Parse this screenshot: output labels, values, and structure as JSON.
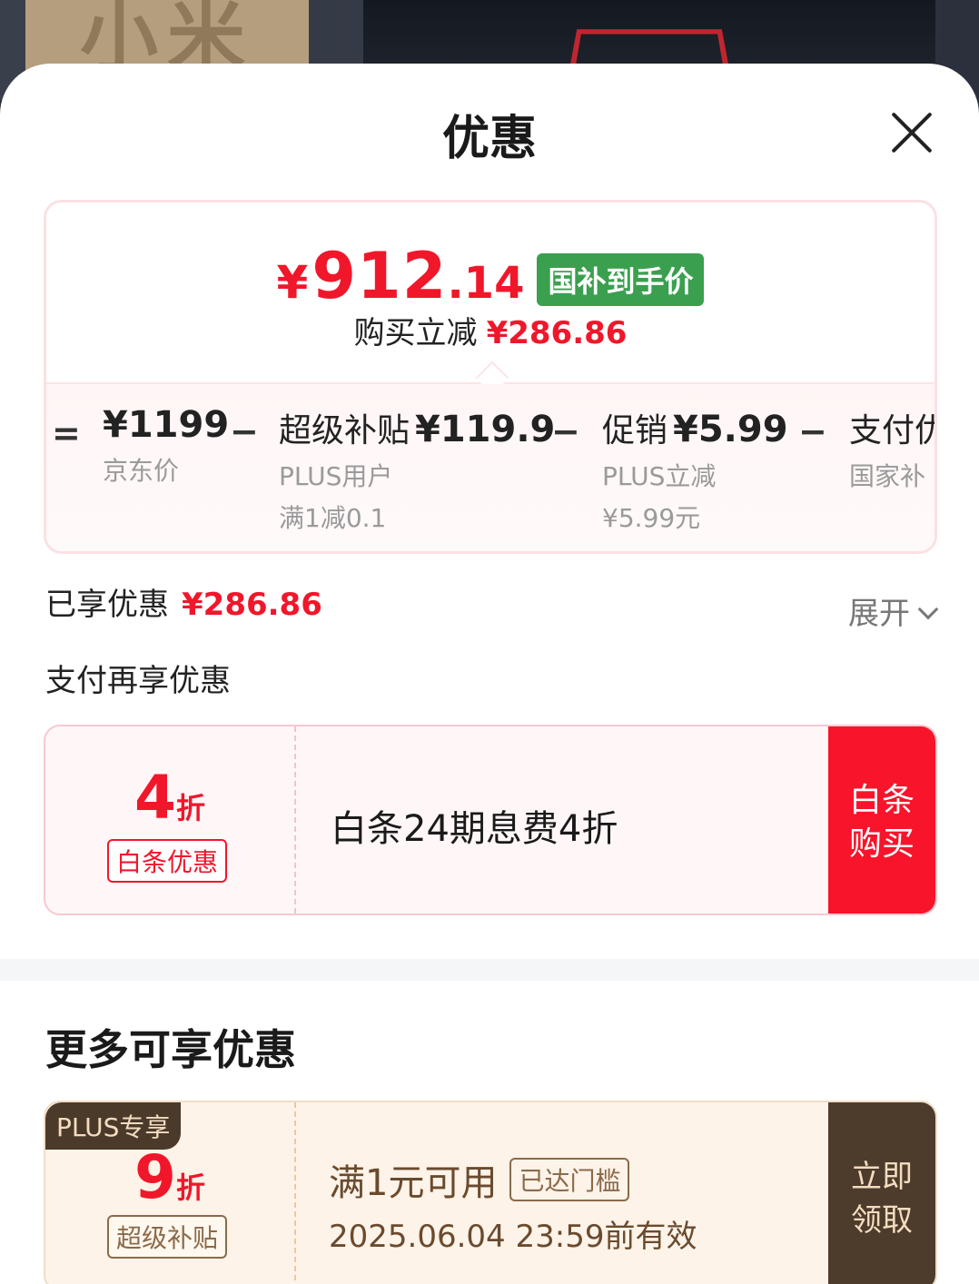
{
  "background": {
    "banner_text": "小米显示器"
  },
  "sheet": {
    "title": "优惠"
  },
  "price_card": {
    "currency": "¥",
    "price_int": "912",
    "price_dec": ".14",
    "badge": "国补到手价",
    "saved_label": "购买立减",
    "saved_amount": "¥286.86",
    "breakdown": [
      {
        "op": "=",
        "name": "",
        "value": "¥1199",
        "sub1": "京东价",
        "sub2": ""
      },
      {
        "op": "−",
        "name": "超级补贴",
        "value": "¥119.9",
        "sub1": "PLUS用户",
        "sub2": "满1减0.1"
      },
      {
        "op": "−",
        "name": "促销",
        "value": "¥5.99",
        "sub1": "PLUS立减",
        "sub2": "¥5.99元"
      },
      {
        "op": "−",
        "name": "支付优",
        "value": "",
        "sub1": "国家补",
        "sub2": ""
      }
    ]
  },
  "enjoyed": {
    "label": "已享优惠",
    "amount": "¥286.86",
    "expand_label": "展开"
  },
  "pay_section": {
    "title": "支付再享优惠"
  },
  "coupon_baitiao": {
    "discount_num": "4",
    "discount_unit": "折",
    "tag": "白条优惠",
    "desc": "白条24期息费4折",
    "button_line1": "白条",
    "button_line2": "购买"
  },
  "more_section": {
    "title": "更多可享优惠"
  },
  "coupon_plus": {
    "plus_badge": "PLUS专享",
    "discount_num": "9",
    "discount_unit": "折",
    "tag": "超级补贴",
    "condition": "满1元可用",
    "reached_badge": "已达门槛",
    "validity": "2025.06.04 23:59前有效",
    "button_line1": "立即",
    "button_line2": "领取"
  },
  "colors": {
    "accent_red": "#f0172b",
    "green_badge": "#3aa04f",
    "plus_brown": "#4d3b2b"
  }
}
